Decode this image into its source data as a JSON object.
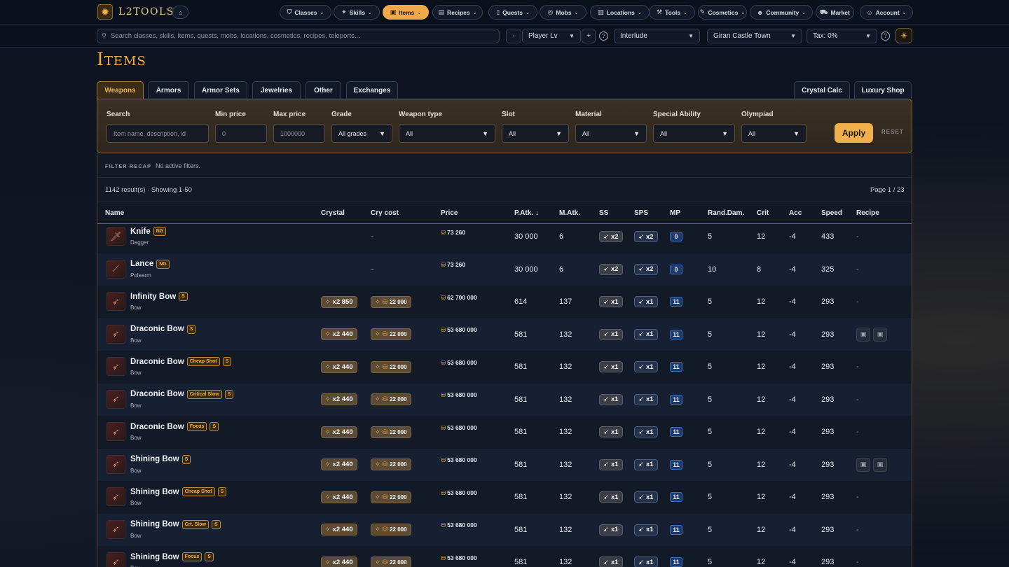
{
  "brand": {
    "name": "L2TOOLS"
  },
  "nav": [
    {
      "label": "Classes",
      "icon": "shield-icon",
      "active": false
    },
    {
      "label": "Skills",
      "icon": "sparkles-icon",
      "active": false
    },
    {
      "label": "Items",
      "icon": "box-icon",
      "active": true
    },
    {
      "label": "Recipes",
      "icon": "scroll-icon",
      "active": false
    },
    {
      "label": "Quests",
      "icon": "book-icon",
      "active": false
    },
    {
      "label": "Mobs",
      "icon": "target-icon",
      "active": false
    },
    {
      "label": "Locations",
      "icon": "map-icon",
      "active": false
    },
    {
      "label": "Tools",
      "icon": "wrench-icon",
      "active": false
    },
    {
      "label": "Cosmetics",
      "icon": "brush-icon",
      "active": false
    },
    {
      "label": "Community",
      "icon": "users-icon",
      "active": false
    },
    {
      "label": "Market",
      "icon": "cart-icon",
      "active": false
    },
    {
      "label": "Account",
      "icon": "user-icon",
      "active": false
    }
  ],
  "searchbar": {
    "placeholder": "Search classes, skills, items, quests, mobs, locations, cosmetics, recipes, teleports...",
    "minus": "-",
    "player_lv": "Player Lv",
    "plus": "+",
    "chronicle": "Interlude",
    "town": "Giran Castle Town",
    "tax": "Tax: 0%"
  },
  "page": {
    "title": "Items"
  },
  "tabs": [
    "Weapons",
    "Armors",
    "Armor Sets",
    "Jewelries",
    "Other",
    "Exchanges"
  ],
  "right_tabs": [
    "Crystal Calc",
    "Luxury Shop"
  ],
  "filters": {
    "search_label": "Search",
    "search_placeholder": "Item name, description, id",
    "min_label": "Min price",
    "min_placeholder": "0",
    "max_label": "Max price",
    "max_placeholder": "1000000",
    "grade_label": "Grade",
    "grade_value": "All grades",
    "weapon_type_label": "Weapon type",
    "weapon_type_value": "All",
    "slot_label": "Slot",
    "slot_value": "All",
    "material_label": "Material",
    "material_value": "All",
    "special_label": "Special Ability",
    "special_value": "All",
    "olympiad_label": "Olympiad",
    "olympiad_value": "All",
    "apply": "Apply",
    "reset": "RESET"
  },
  "recap": {
    "label": "FILTER RECAP",
    "text": "No active filters."
  },
  "results": {
    "count": "1142 result(s) · Showing 1-50",
    "page": "Page 1 / 23"
  },
  "columns": [
    "Name",
    "Crystal",
    "Cry cost",
    "Price",
    "P.Atk. ↓",
    "M.Atk.",
    "SS",
    "SPS",
    "MP",
    "Rand.Dam.",
    "Crit",
    "Acc",
    "Speed",
    "Recipe"
  ],
  "rows": [
    {
      "name": "Knife",
      "tags": [
        "NG"
      ],
      "type": "Dagger",
      "crystal": "-",
      "cry_cost": "-",
      "price": "73 260",
      "patk": "30 000",
      "matk": "6",
      "ss": "x2",
      "sps": "x2",
      "mp": "0",
      "rand": "5",
      "crit": "12",
      "acc": "-4",
      "speed": "433",
      "recipe": "-"
    },
    {
      "name": "Lance",
      "tags": [
        "NG"
      ],
      "type": "Polearm",
      "crystal": "-",
      "cry_cost": "-",
      "price": "73 260",
      "patk": "30 000",
      "matk": "6",
      "ss": "x2",
      "sps": "x2",
      "mp": "0",
      "rand": "10",
      "crit": "8",
      "acc": "-4",
      "speed": "325",
      "recipe": "-"
    },
    {
      "name": "Infinity Bow",
      "tags": [
        "S"
      ],
      "type": "Bow",
      "crystal": "x2 850",
      "cry_cost": "22 000",
      "price": "62 700 000",
      "patk": "614",
      "matk": "137",
      "ss": "x1",
      "sps": "x1",
      "mp": "11",
      "rand": "5",
      "crit": "12",
      "acc": "-4",
      "speed": "293",
      "recipe": "-"
    },
    {
      "name": "Draconic Bow",
      "tags": [
        "S"
      ],
      "type": "Bow",
      "crystal": "x2 440",
      "cry_cost": "22 000",
      "price": "53 680 000",
      "patk": "581",
      "matk": "132",
      "ss": "x1",
      "sps": "x1",
      "mp": "11",
      "rand": "5",
      "crit": "12",
      "acc": "-4",
      "speed": "293",
      "recipe": "icons"
    },
    {
      "name": "Draconic Bow",
      "tags": [
        "Cheap Shot",
        "S"
      ],
      "type": "Bow",
      "crystal": "x2 440",
      "cry_cost": "22 000",
      "price": "53 680 000",
      "patk": "581",
      "matk": "132",
      "ss": "x1",
      "sps": "x1",
      "mp": "11",
      "rand": "5",
      "crit": "12",
      "acc": "-4",
      "speed": "293",
      "recipe": "-"
    },
    {
      "name": "Draconic Bow",
      "tags": [
        "Critical Slow",
        "S"
      ],
      "type": "Bow",
      "crystal": "x2 440",
      "cry_cost": "22 000",
      "price": "53 680 000",
      "patk": "581",
      "matk": "132",
      "ss": "x1",
      "sps": "x1",
      "mp": "11",
      "rand": "5",
      "crit": "12",
      "acc": "-4",
      "speed": "293",
      "recipe": "-"
    },
    {
      "name": "Draconic Bow",
      "tags": [
        "Focus",
        "S"
      ],
      "type": "Bow",
      "crystal": "x2 440",
      "cry_cost": "22 000",
      "price": "53 680 000",
      "patk": "581",
      "matk": "132",
      "ss": "x1",
      "sps": "x1",
      "mp": "11",
      "rand": "5",
      "crit": "12",
      "acc": "-4",
      "speed": "293",
      "recipe": "-"
    },
    {
      "name": "Shining Bow",
      "tags": [
        "S"
      ],
      "type": "Bow",
      "crystal": "x2 440",
      "cry_cost": "22 000",
      "price": "53 680 000",
      "patk": "581",
      "matk": "132",
      "ss": "x1",
      "sps": "x1",
      "mp": "11",
      "rand": "5",
      "crit": "12",
      "acc": "-4",
      "speed": "293",
      "recipe": "icons"
    },
    {
      "name": "Shining Bow",
      "tags": [
        "Cheap Shot",
        "S"
      ],
      "type": "Bow",
      "crystal": "x2 440",
      "cry_cost": "22 000",
      "price": "53 680 000",
      "patk": "581",
      "matk": "132",
      "ss": "x1",
      "sps": "x1",
      "mp": "11",
      "rand": "5",
      "crit": "12",
      "acc": "-4",
      "speed": "293",
      "recipe": "-"
    },
    {
      "name": "Shining Bow",
      "tags": [
        "Crt. Slow",
        "S"
      ],
      "type": "Bow",
      "crystal": "x2 440",
      "cry_cost": "22 000",
      "price": "53 680 000",
      "patk": "581",
      "matk": "132",
      "ss": "x1",
      "sps": "x1",
      "mp": "11",
      "rand": "5",
      "crit": "12",
      "acc": "-4",
      "speed": "293",
      "recipe": "-"
    },
    {
      "name": "Shining Bow",
      "tags": [
        "Focus",
        "S"
      ],
      "type": "Bow",
      "crystal": "x2 440",
      "cry_cost": "22 000",
      "price": "53 680 000",
      "patk": "581",
      "matk": "132",
      "ss": "x1",
      "sps": "x1",
      "mp": "11",
      "rand": "5",
      "crit": "12",
      "acc": "-4",
      "speed": "293",
      "recipe": "-"
    }
  ]
}
